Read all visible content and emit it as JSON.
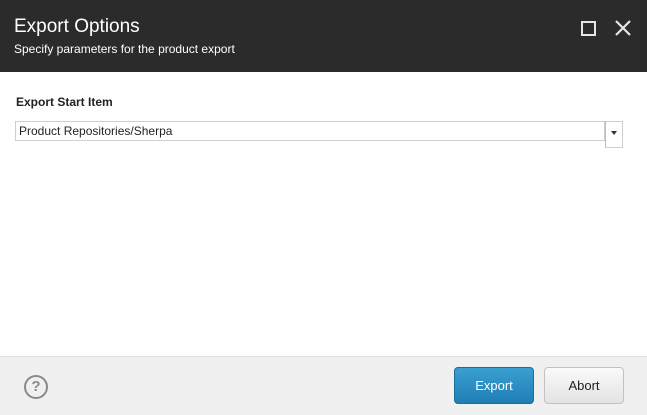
{
  "dialog": {
    "title": "Export Options",
    "subtitle": "Specify parameters for the product export",
    "maximize_icon": "maximize-icon",
    "close_icon": "close-icon"
  },
  "form": {
    "start_item_label": "Export Start Item",
    "start_item_value": "Product Repositories/Sherpa",
    "dropdown_icon": "chevron-down-icon"
  },
  "footer": {
    "help_label": "?",
    "export_label": "Export",
    "abort_label": "Abort"
  },
  "colors": {
    "header_bg": "#2b2b2b",
    "primary_button": "#2a8cc4",
    "footer_bg": "#f0f0f0"
  }
}
